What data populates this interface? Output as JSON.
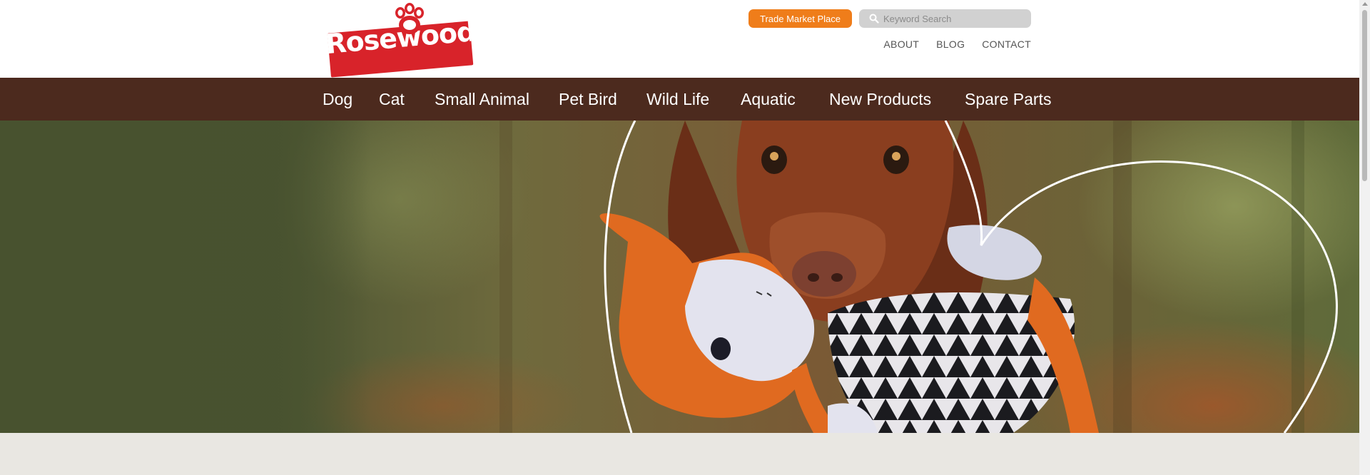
{
  "header": {
    "logo_text": "Rosewood",
    "trade_button": "Trade Market Place",
    "search": {
      "placeholder": "Keyword Search",
      "value": ""
    },
    "links": [
      "ABOUT",
      "BLOG",
      "CONTACT"
    ]
  },
  "nav": {
    "items": [
      "Dog",
      "Cat",
      "Small Animal",
      "Pet Bird",
      "Wild Life",
      "Aquatic",
      "New Products",
      "Spare Parts"
    ]
  },
  "colors": {
    "brand_red": "#d8232a",
    "accent_orange": "#ef7d1a",
    "nav_brown": "#4c2a1e",
    "page_bg": "#e9e7e2"
  },
  "icons": {
    "search": "search-icon",
    "paw": "paw-icon"
  }
}
